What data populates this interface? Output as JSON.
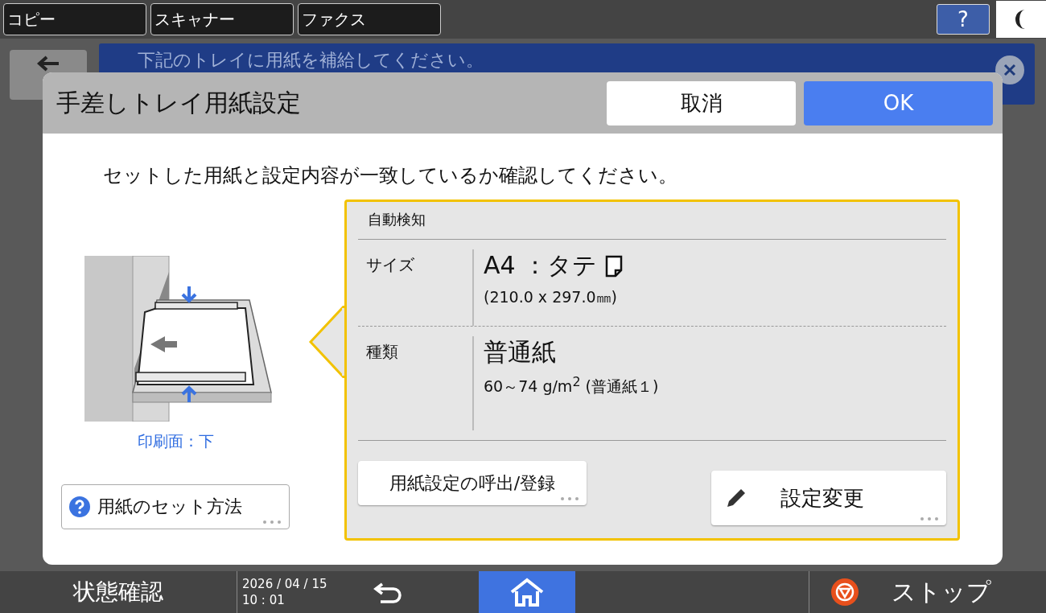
{
  "top_tabs": [
    {
      "label": "コピー"
    },
    {
      "label": "スキャナー"
    },
    {
      "label": "ファクス"
    }
  ],
  "help_button": "?",
  "notice": {
    "text": "下記のトレイに用紙を補給してください。"
  },
  "dialog": {
    "title": "手差しトレイ用紙設定",
    "buttons": [
      {
        "label": "取消",
        "kind": "secondary"
      },
      {
        "label": "OK",
        "kind": "primary"
      }
    ],
    "message": "セットした用紙と設定内容が一致しているか確認してください。",
    "illustration_caption": "印刷面：下",
    "help_link": "用紙のセット方法",
    "detection": {
      "heading": "自動検知",
      "rows": [
        {
          "kind": "size",
          "label": "サイズ",
          "value": "A4 ：タテ",
          "detail": "(210.0 x 297.0㎜)"
        },
        {
          "kind": "type",
          "label": "種類",
          "value": "普通紙",
          "detail": "60～74 g/m$^{2}$ (普通紙１)"
        }
      ],
      "buttons": [
        {
          "kind": "plain",
          "label": "用紙設定の呼出/登録"
        },
        {
          "kind": "edit",
          "label": "設定変更"
        }
      ]
    }
  },
  "bottom_bar": {
    "status": "状態確認",
    "date": "2026 / 04 / 15",
    "time": "10 : 01",
    "stop": "ストップ"
  }
}
